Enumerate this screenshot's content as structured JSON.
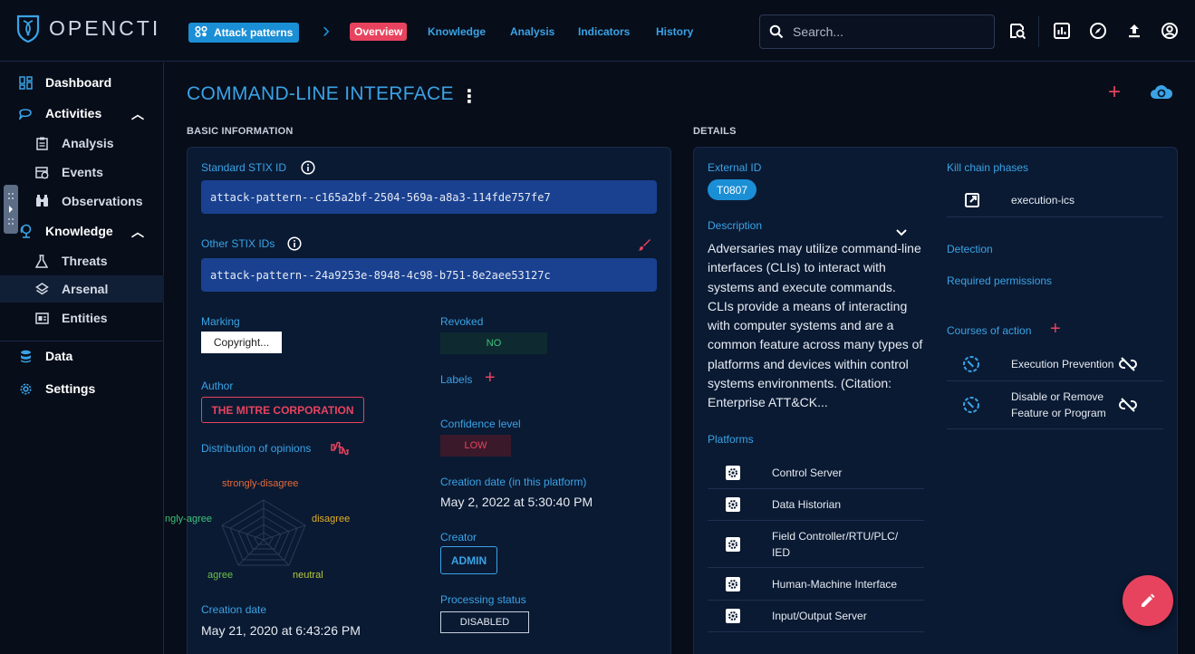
{
  "app": {
    "logo_text": "OPENCTI"
  },
  "topbar": {
    "entity_type": "Attack patterns",
    "tabs": [
      {
        "label": "Overview",
        "active": true
      },
      {
        "label": "Knowledge"
      },
      {
        "label": "Analysis"
      },
      {
        "label": "Indicators"
      },
      {
        "label": "History"
      }
    ],
    "search_placeholder": "Search...",
    "icons": [
      "search-advanced-icon",
      "dashboard-icon",
      "explore-icon",
      "upload-icon",
      "account-icon"
    ]
  },
  "leftnav": {
    "items": [
      {
        "label": "Dashboard",
        "icon": "dashboard-icon"
      },
      {
        "label": "Activities",
        "icon": "activities-icon",
        "expanded": true
      },
      {
        "label": "Analysis",
        "icon": "analysis-icon"
      },
      {
        "label": "Events",
        "icon": "events-icon"
      },
      {
        "label": "Observations",
        "icon": "binoculars-icon"
      },
      {
        "label": "Knowledge",
        "icon": "knowledge-icon",
        "expanded": true
      },
      {
        "label": "Threats",
        "icon": "threats-icon"
      },
      {
        "label": "Arsenal",
        "icon": "arsenal-icon",
        "selected": true
      },
      {
        "label": "Entities",
        "icon": "entities-icon"
      },
      {
        "label": "Data",
        "icon": "database-icon"
      },
      {
        "label": "Settings",
        "icon": "settings-icon"
      }
    ]
  },
  "page": {
    "title": "COMMAND-LINE INTERFACE"
  },
  "basic": {
    "section_title": "BASIC INFORMATION",
    "standard_stix_id_label": "Standard STIX ID",
    "standard_stix_id": "attack-pattern--c165a2bf-2504-569a-a8a3-114fde757fe7",
    "other_stix_ids_label": "Other STIX IDs",
    "other_stix_id": "attack-pattern--24a9253e-8948-4c98-b751-8e2aee53127c",
    "marking_label": "Marking",
    "marking": "Copyright...",
    "revoked_label": "Revoked",
    "revoked": "NO",
    "author_label": "Author",
    "author": "THE MITRE CORPORATION",
    "labels_label": "Labels",
    "confidence_label": "Confidence level",
    "confidence": "LOW",
    "opinions_label": "Distribution of opinions",
    "radar_labels": {
      "strongly_disagree": "strongly-disagree",
      "disagree": "disagree",
      "neutral": "neutral",
      "agree": "agree",
      "strongly_agree": "ngly-agree"
    },
    "creation_platform_label": "Creation date (in this platform)",
    "creation_platform": "May 2, 2022 at 5:30:40 PM",
    "creator_label": "Creator",
    "creator": "ADMIN",
    "creation_date_label": "Creation date",
    "creation_date": "May 21, 2020 at 6:43:26 PM",
    "processing_label": "Processing status",
    "processing": "DISABLED"
  },
  "details": {
    "section_title": "DETAILS",
    "external_id_label": "External ID",
    "external_id": "T0807",
    "description_label": "Description",
    "description": "Adversaries may utilize command-line interfaces (CLIs) to interact with systems and execute commands. CLIs provide a means of interacting with computer systems and are a common feature across many types of platforms and devices within control systems environments. (Citation: Enterprise ATT&CK...",
    "platforms_label": "Platforms",
    "platforms": [
      "Control Server",
      "Data Historian",
      "Field Controller/RTU/PLC/ IED",
      "Human-Machine Interface",
      "Input/Output Server"
    ],
    "kill_chain_label": "Kill chain phases",
    "kill_chain": [
      "execution-ics"
    ],
    "detection_label": "Detection",
    "permissions_label": "Required permissions",
    "coa_label": "Courses of action",
    "coa": [
      "Execution Prevention",
      "Disable or Remove Feature or Program"
    ]
  },
  "colors": {
    "accent": "#3aa3e6",
    "secondary": "#e8435e",
    "background": "#070d19",
    "card": "#0a1a33"
  }
}
